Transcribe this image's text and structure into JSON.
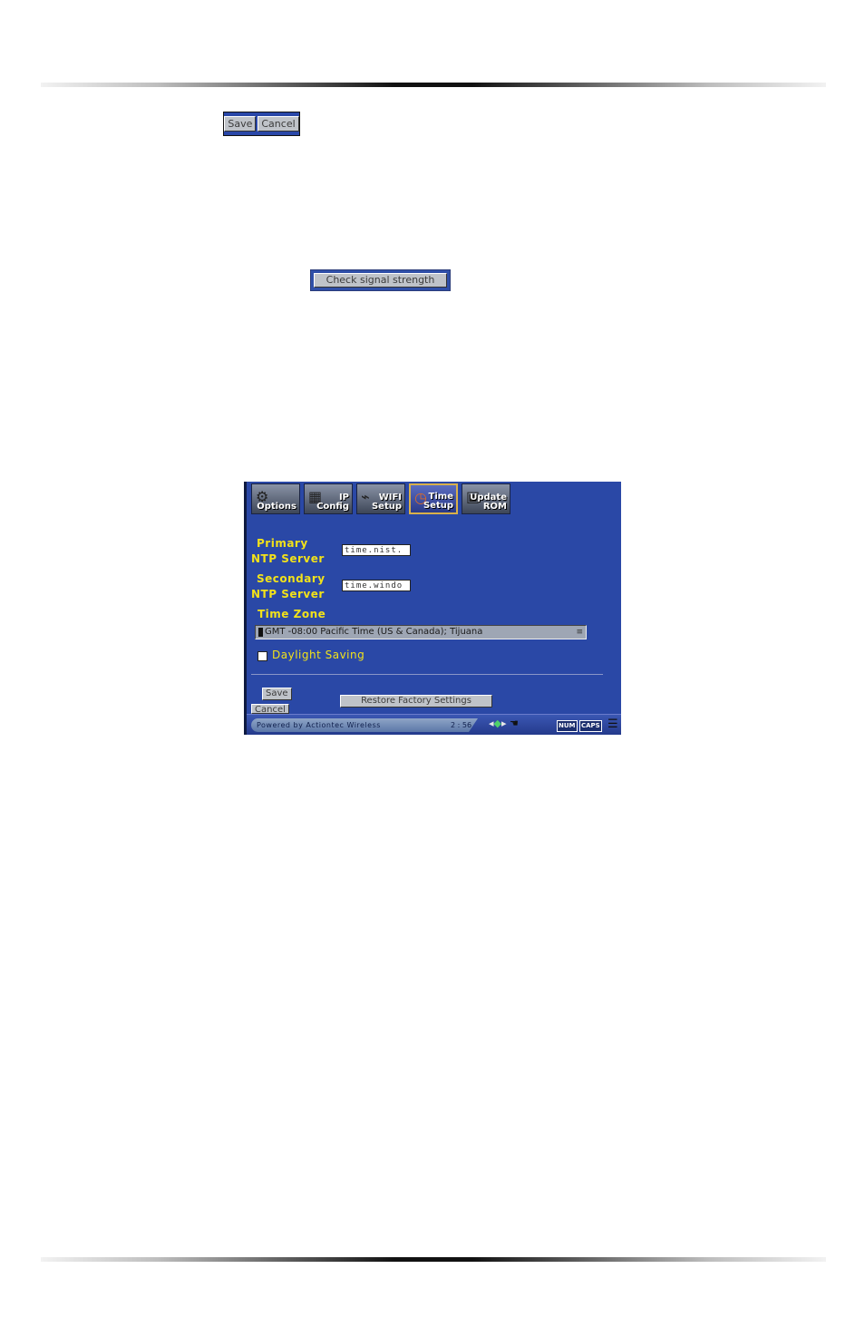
{
  "save_cancel": {
    "save": "Save",
    "cancel": "Cancel"
  },
  "signal": {
    "button": "Check signal strength"
  },
  "tabs": [
    {
      "label": "Options",
      "icon": "options-icon",
      "glyph": "⚙"
    },
    {
      "label": "IP Config",
      "icon": "network-icon",
      "glyph": "▦"
    },
    {
      "label": "WIFI Setup",
      "icon": "wifi-router-icon",
      "glyph": "⌁"
    },
    {
      "label": "Time Setup",
      "icon": "clock-icon",
      "glyph": "◷"
    },
    {
      "label": "Update ROM",
      "icon": "chip-icon",
      "glyph": "▣"
    }
  ],
  "form": {
    "primary_label_1": "Primary",
    "primary_label_2": "NTP Server",
    "primary_value": "time.nist.",
    "secondary_label_1": "Secondary",
    "secondary_label_2": "NTP Server",
    "secondary_value": "time.windo",
    "timezone_label": "Time Zone",
    "timezone_value": "GMT -08:00 Pacific Time (US & Canada); Tijuana",
    "daylight_label": "Daylight Saving",
    "save": "Save",
    "cancel": "Cancel",
    "restore": "Restore Factory Settings"
  },
  "status": {
    "powered": "Powered by Actiontec Wireless",
    "time": "2 : 56",
    "num": "NUM",
    "caps": "CAPS"
  }
}
